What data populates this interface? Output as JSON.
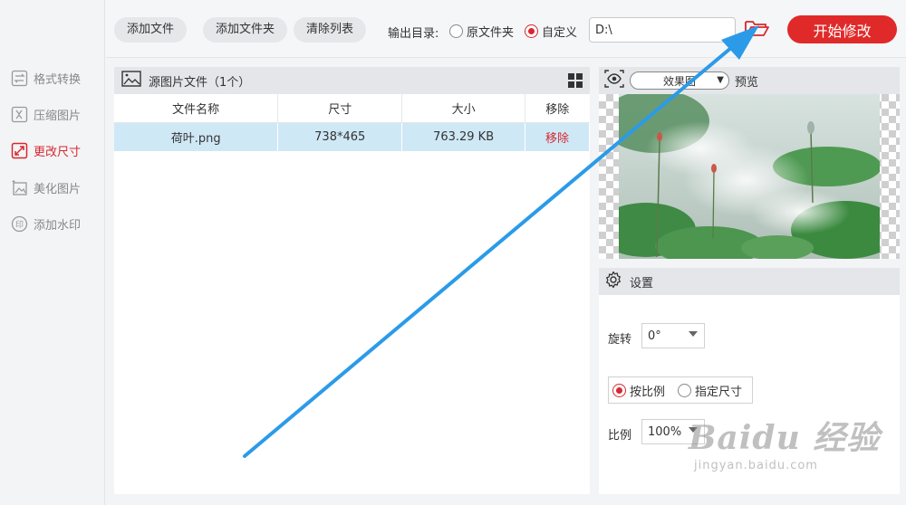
{
  "sidebar": {
    "items": [
      {
        "label": "格式转换",
        "icon": "convert-icon",
        "active": false
      },
      {
        "label": "压缩图片",
        "icon": "compress-icon",
        "active": false
      },
      {
        "label": "更改尺寸",
        "icon": "resize-icon",
        "active": true
      },
      {
        "label": "美化图片",
        "icon": "beautify-icon",
        "active": false
      },
      {
        "label": "添加水印",
        "icon": "watermark-icon",
        "active": false
      }
    ]
  },
  "toolbar": {
    "add_file": "添加文件",
    "add_folder": "添加文件夹",
    "clear_list": "清除列表",
    "output_label": "输出目录:",
    "radio_original": "原文件夹",
    "radio_custom": "自定义",
    "selected_radio": "custom",
    "path_value": "D:\\",
    "start_button": "开始修改"
  },
  "file_panel": {
    "title": "源图片文件（1个）",
    "columns": [
      "文件名称",
      "尺寸",
      "大小",
      "移除"
    ],
    "rows": [
      {
        "name": "荷叶.png",
        "size": "738*465",
        "filesize": "763.29 KB",
        "remove": "移除"
      }
    ]
  },
  "preview": {
    "effect_select": "效果图",
    "label": "预览"
  },
  "settings": {
    "title": "设置",
    "rotate_label": "旋转",
    "rotate_value": "0°",
    "mode_ratio": "按比例",
    "mode_size": "指定尺寸",
    "selected_mode": "ratio",
    "ratio_label": "比例",
    "ratio_value": "100%"
  },
  "watermark": {
    "brand": "Baidu 经验",
    "url": "jingyan.baidu.com"
  },
  "colors": {
    "accent": "#d7282f",
    "start_button": "#e02a2a",
    "selected_row": "#cfe8f6",
    "arrow": "#2b9be8"
  }
}
